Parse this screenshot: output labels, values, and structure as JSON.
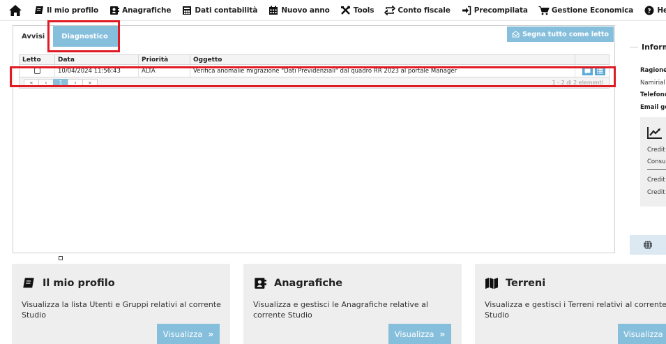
{
  "navbar": {
    "items": [
      {
        "label": "Il mio profilo",
        "icon": "book-icon"
      },
      {
        "label": "Anagrafiche",
        "icon": "address-book-icon"
      },
      {
        "label": "Dati contabilità",
        "icon": "calculator-icon"
      },
      {
        "label": "Nuovo anno",
        "icon": "calendar-icon"
      },
      {
        "label": "Tools",
        "icon": "tools-icon"
      },
      {
        "label": "Conto fiscale",
        "icon": "exchange-icon"
      },
      {
        "label": "Precompilata",
        "icon": "sign-in-icon"
      },
      {
        "label": "Gestione Economica",
        "icon": "cart-icon"
      },
      {
        "label": "Help",
        "icon": "question-icon"
      }
    ]
  },
  "tabs": [
    "Avvisi",
    "Diagnostico"
  ],
  "mark_all_read": "Segna tutto come letto",
  "grid": {
    "columns": [
      "Letto",
      "Data",
      "Priorità",
      "Oggetto"
    ],
    "rows": [
      {
        "data": "10/04/2024 11:56:43",
        "priorita": "ALTA",
        "oggetto": "Verifica anomalie migrazione \"Dati Previdenziali\" dal quadro RR 2023 al portale Manager"
      }
    ],
    "pager": {
      "first": "«",
      "prev": "‹",
      "page": "1",
      "next": "›",
      "last": "»",
      "info": "1 - 2 di 2 elementi"
    }
  },
  "info_panel": {
    "title": "Inform",
    "labels": [
      "Ragione",
      "Namirial",
      "Telefono",
      "Email ge"
    ],
    "credit_lines": [
      "Credit",
      "Consu",
      "Credit",
      "Credit"
    ]
  },
  "cards": [
    {
      "title": "Il mio profilo",
      "icon": "book-icon",
      "desc": "Visualizza la lista Utenti e Gruppi relativi al corrente Studio",
      "button": "Visualizza",
      "arrow": "»"
    },
    {
      "title": "Anagrafiche",
      "icon": "address-book-icon",
      "desc": "Visualizza e gestisci le Anagrafiche relative al corrente Studio",
      "button": "Visualizza",
      "arrow": "»"
    },
    {
      "title": "Terreni",
      "icon": "map-icon",
      "desc": "Visualizza e gestisci i Terreni relativi al corrente Studio",
      "button": "Visualizza",
      "arrow": "»"
    }
  ],
  "colors": {
    "accent": "#86bfdc",
    "action": "#5aa9d6",
    "highlight": "#e01b24"
  }
}
